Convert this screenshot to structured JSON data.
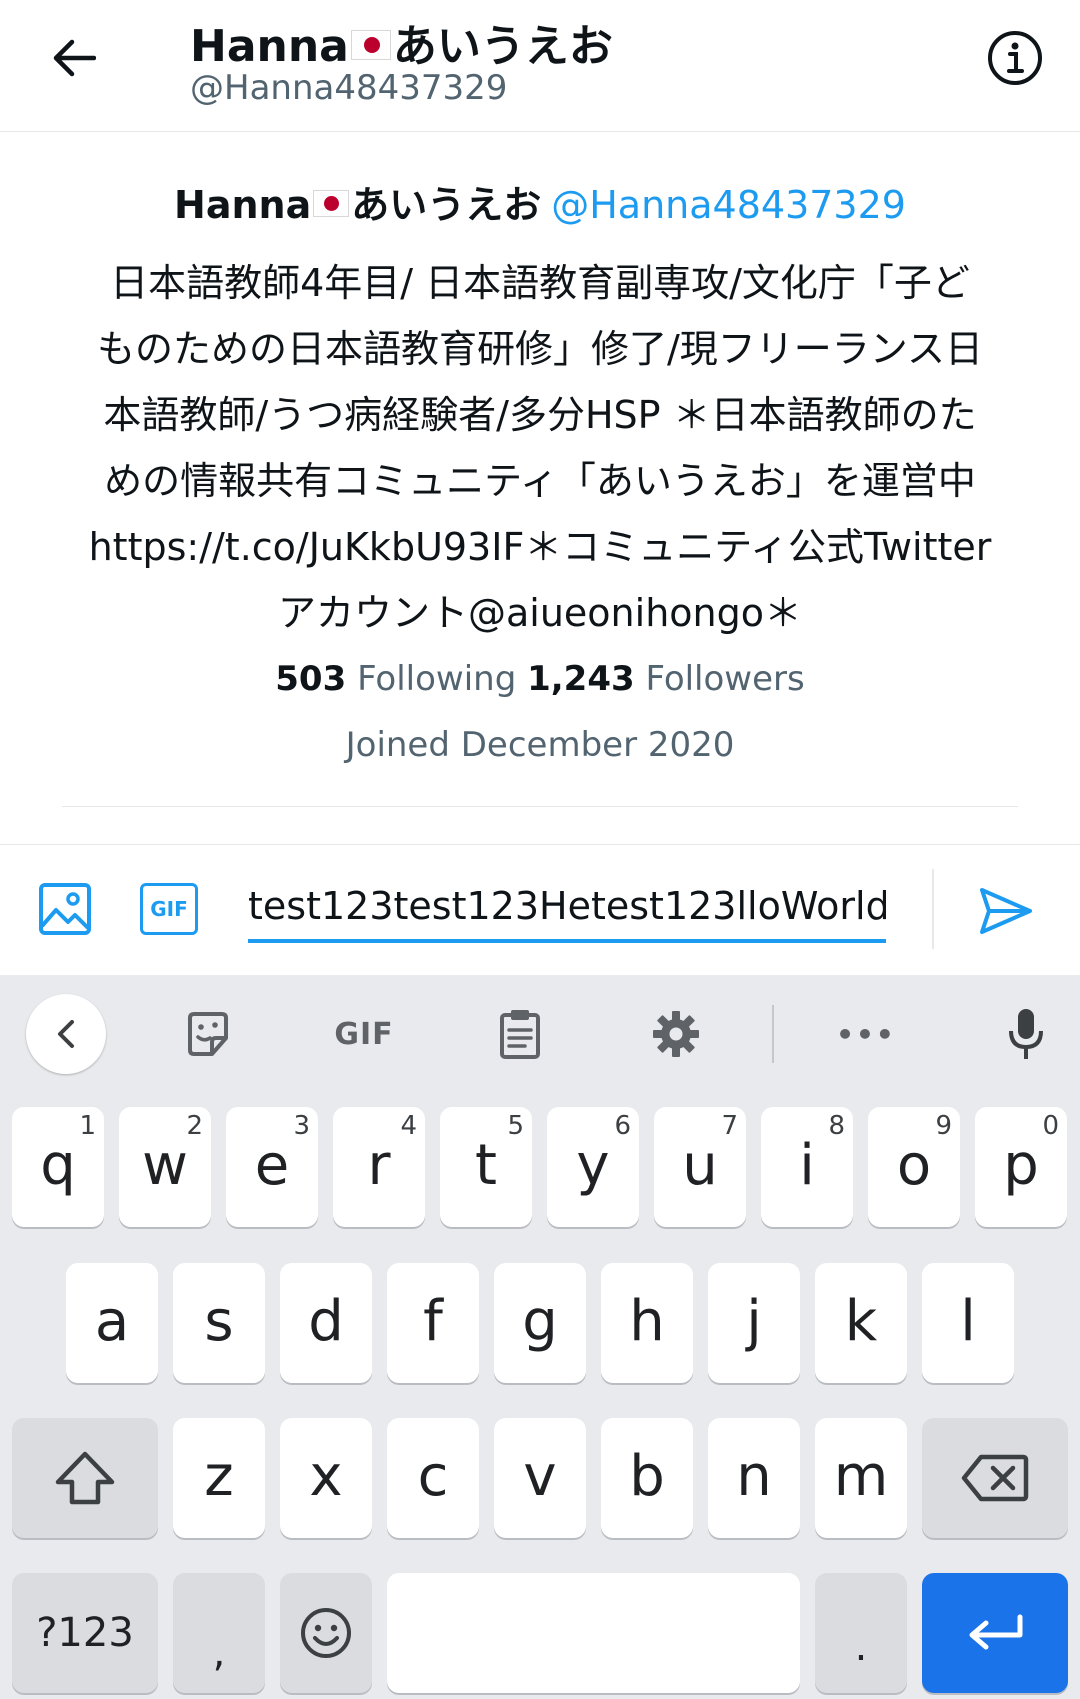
{
  "header": {
    "name": "Hanna",
    "name_suffix": "あいうえお",
    "handle": "@Hanna48437329"
  },
  "profile": {
    "name": "Hanna",
    "name_suffix": "あいうえお",
    "handle": "@Hanna48437329",
    "bio_lines": [
      "日本語教師4年目/ 日本語教育副専攻/文化庁「子ど",
      "ものための日本語教育研修」修了/現フリーランス日",
      "本語教師/うつ病経験者/多分HSP ＊日本語教師のた",
      "めの情報共有コミュニティ「あいうえお」を運営中",
      "https://t.co/JuKkbU93IF＊コミュニティ公式Twitter",
      "アカウント@aiueonihongo＊"
    ],
    "following_count": "503",
    "following_label": "Following",
    "followers_count": "1,243",
    "followers_label": "Followers",
    "joined": "Joined December 2020"
  },
  "composer": {
    "gif_label": "GIF",
    "message_value": "test123test123Hetest123lloWorld"
  },
  "keyboard": {
    "toolbar": {
      "gif_label": "GIF",
      "more_label": "•••"
    },
    "row1": [
      {
        "key": "q",
        "hint": "1"
      },
      {
        "key": "w",
        "hint": "2"
      },
      {
        "key": "e",
        "hint": "3"
      },
      {
        "key": "r",
        "hint": "4"
      },
      {
        "key": "t",
        "hint": "5"
      },
      {
        "key": "y",
        "hint": "6"
      },
      {
        "key": "u",
        "hint": "7"
      },
      {
        "key": "i",
        "hint": "8"
      },
      {
        "key": "o",
        "hint": "9"
      },
      {
        "key": "p",
        "hint": "0"
      }
    ],
    "row2": [
      "a",
      "s",
      "d",
      "f",
      "g",
      "h",
      "j",
      "k",
      "l"
    ],
    "row3": [
      "z",
      "x",
      "c",
      "v",
      "b",
      "n",
      "m"
    ],
    "row4": {
      "symbols": "?123",
      "comma": ",",
      "period": "."
    }
  },
  "colors": {
    "accent": "#1d9bf0",
    "enter_key": "#1a73e8",
    "flag_red": "#bc002d"
  }
}
